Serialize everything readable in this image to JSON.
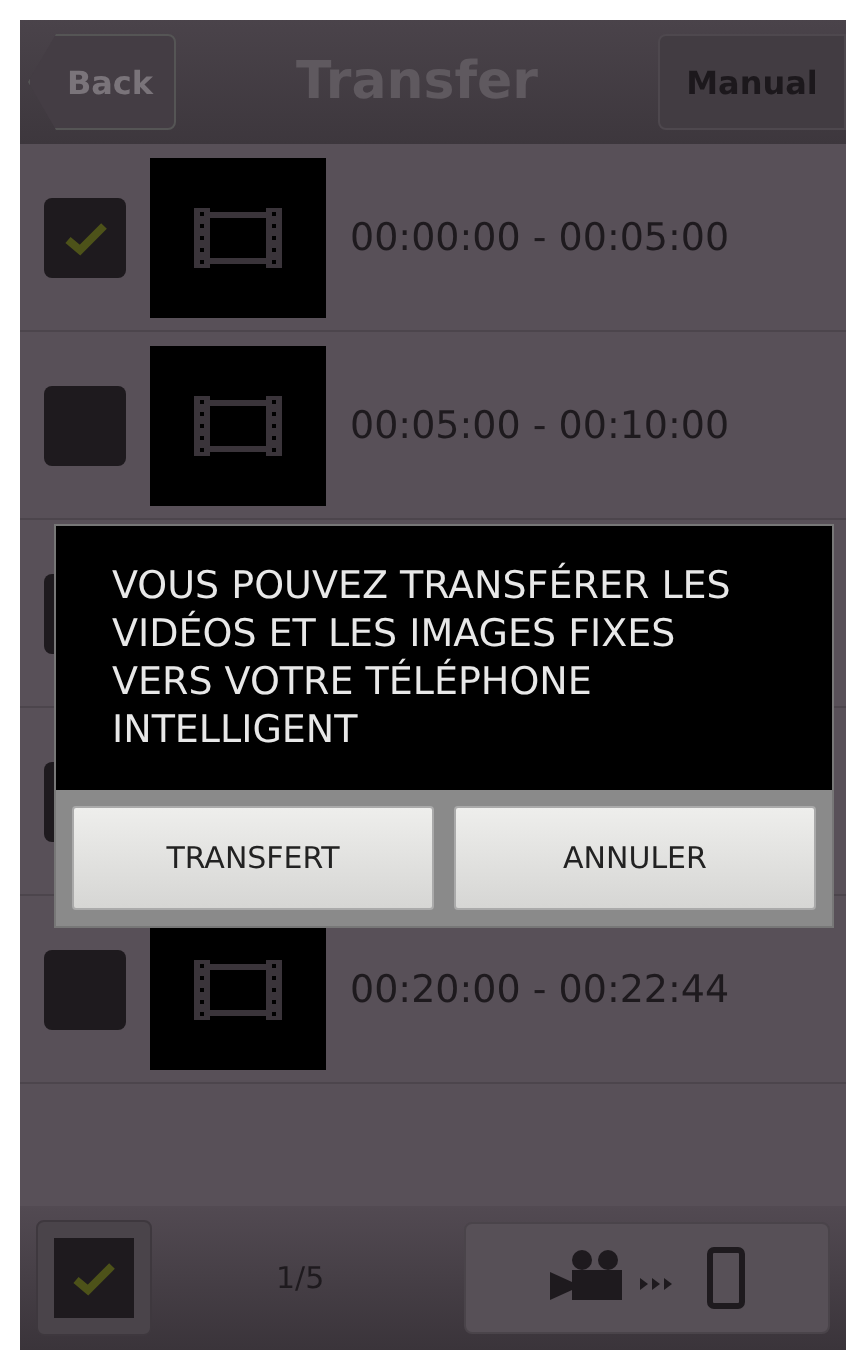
{
  "header": {
    "back": "Back",
    "title": "Transfer",
    "manual": "Manual"
  },
  "rows": [
    {
      "time": "00:00:00 - 00:05:00",
      "checked": true
    },
    {
      "time": "00:05:00 - 00:10:00",
      "checked": false
    },
    {},
    {},
    {
      "time": "00:20:00 - 00:22:44",
      "checked": false
    }
  ],
  "dialog": {
    "message": "VOUS POUVEZ TRANSFÉRER LES VIDÉOS ET LES IMAGES FIXES VERS VOTRE TÉLÉPHONE INTELLIGENT",
    "buttons": [
      "TRANSFERT",
      "ANNULER"
    ]
  },
  "footer": {
    "select_all_checked": true,
    "count": "1/5"
  }
}
